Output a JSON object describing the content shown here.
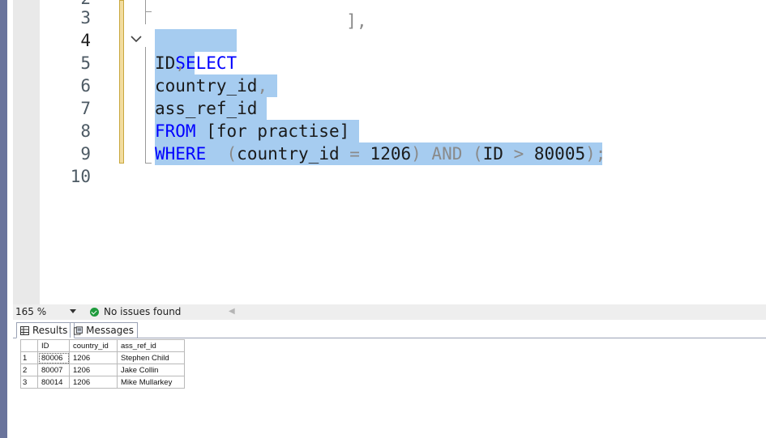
{
  "editor": {
    "line_numbers": [
      "3",
      "4",
      "5",
      "6",
      "7",
      "8",
      "9",
      "10"
    ],
    "partial_top_number": "2",
    "lines": {
      "l4_kw": "SELECT",
      "l5_a": "ID",
      "l5_b": ",",
      "l6_a": "country_id",
      "l6_b": ",",
      "l7": "ass_ref_id",
      "l8_kw": "FROM",
      "l8_rest": " [for practise]",
      "l9_kw": "WHERE",
      "l9_a": "  ",
      "l9_p1": "(",
      "l9_b": "country_id ",
      "l9_eq": "=",
      "l9_c": " 1206",
      "l9_p2": ")",
      "l9_and": " AND ",
      "l9_p3": "(",
      "l9_d": "ID ",
      "l9_gt": ">",
      "l9_e": " 80005",
      "l9_p4": ")",
      "l9_semi": ";"
    },
    "top_partial_text": "],"
  },
  "statusbar": {
    "zoom": "165 %",
    "issues": "No issues found"
  },
  "result_tabs": {
    "results": "Results",
    "messages": "Messages"
  },
  "grid": {
    "columns": [
      "ID",
      "country_id",
      "ass_ref_id"
    ],
    "rows": [
      {
        "n": "1",
        "id": "80006",
        "country_id": "1206",
        "ass_ref_id": "Stephen Child"
      },
      {
        "n": "2",
        "id": "80007",
        "country_id": "1206",
        "ass_ref_id": "Jake Collin"
      },
      {
        "n": "3",
        "id": "80014",
        "country_id": "1206",
        "ass_ref_id": "Mike Mullarkey"
      }
    ]
  },
  "colors": {
    "keyword": "#0000ff",
    "selection": "#a6ccf0",
    "ok": "#1e9b3c"
  }
}
